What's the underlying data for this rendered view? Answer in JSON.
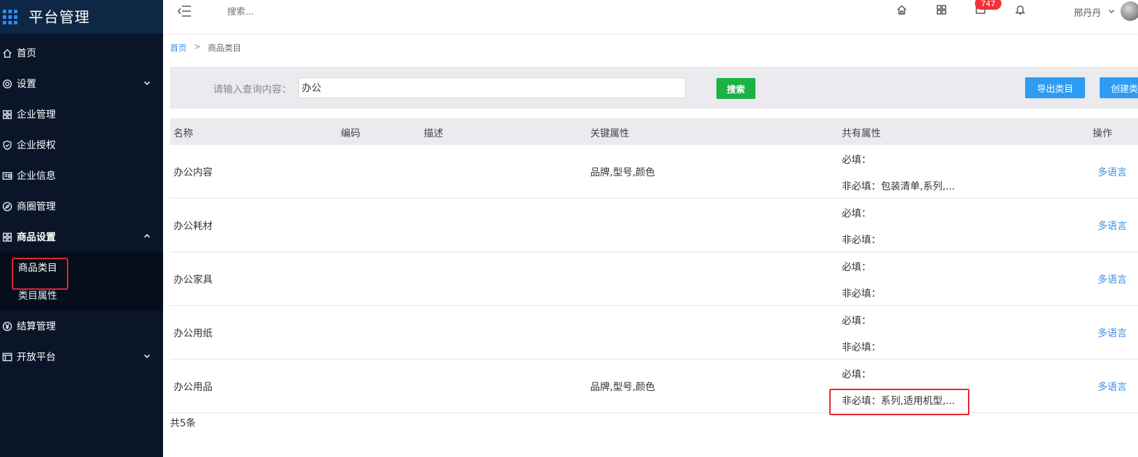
{
  "sidebar": {
    "title": "平台管理",
    "menu": [
      {
        "label": "首页",
        "icon": "home-icon"
      },
      {
        "label": "设置",
        "icon": "gear-icon",
        "has_arrow": true
      },
      {
        "label": "企业管理",
        "icon": "enterprise-icon"
      },
      {
        "label": "企业授权",
        "icon": "shield-icon"
      },
      {
        "label": "企业信息",
        "icon": "id-card-icon"
      },
      {
        "label": "商圈管理",
        "icon": "compass-icon"
      },
      {
        "label": "商品设置",
        "icon": "grid-icon",
        "expanded": true
      },
      {
        "label": "结算管理",
        "icon": "yen-icon"
      },
      {
        "label": "开放平台",
        "icon": "panel-icon",
        "has_arrow": true
      }
    ],
    "submenu": [
      {
        "label": "商品类目",
        "active": true
      },
      {
        "label": "类目属性"
      }
    ]
  },
  "header": {
    "search_placeholder": "搜索...",
    "badge_count": "747",
    "user_name": "邢丹丹"
  },
  "breadcrumb": {
    "home": "首页",
    "separator": ">",
    "current": "商品类目"
  },
  "search": {
    "label": "请输入查询内容：",
    "value": "办公",
    "search_button": "搜索",
    "export_button": "导出类目",
    "create_button": "创建类目"
  },
  "table": {
    "columns": [
      "名称",
      "编码",
      "描述",
      "关键属性",
      "共有属性",
      "操作"
    ],
    "rows": [
      {
        "name": "办公内容",
        "code": "",
        "desc": "",
        "key": "品牌,型号,颜色",
        "required": "必填：",
        "optional": "非必填：包装清单,系列,...",
        "op": "多语言"
      },
      {
        "name": "办公耗材",
        "code": "",
        "desc": "",
        "key": "",
        "required": "必填：",
        "optional": "非必填：",
        "op": "多语言"
      },
      {
        "name": "办公家具",
        "code": "",
        "desc": "",
        "key": "",
        "required": "必填：",
        "optional": "非必填：",
        "op": "多语言"
      },
      {
        "name": "办公用纸",
        "code": "",
        "desc": "",
        "key": "",
        "required": "必填：",
        "optional": "非必填：",
        "op": "多语言"
      },
      {
        "name": "办公用品",
        "code": "",
        "desc": "",
        "key": "品牌,型号,颜色",
        "required": "必填：",
        "optional": "非必填：系列,适用机型,...",
        "op": "多语言"
      }
    ],
    "total": "共5条"
  },
  "colors": {
    "sidebar_bg": "#0a1628",
    "accent_blue": "#2d9cf2",
    "search_green": "#1ab344",
    "highlight_red": "#e5262a"
  }
}
